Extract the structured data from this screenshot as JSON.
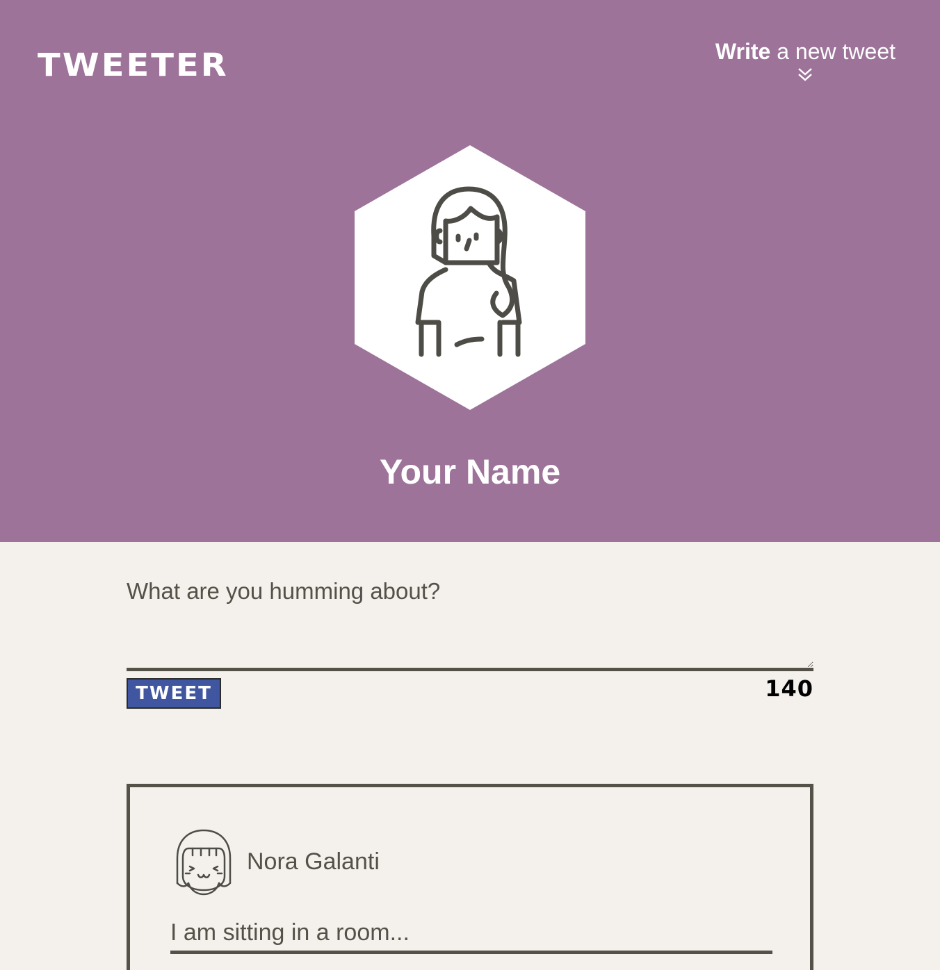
{
  "header": {
    "brand": "TWEETER",
    "compose_toggle": {
      "bold": "Write",
      "rest": " a new tweet"
    },
    "profile": {
      "first": "Your",
      "last": " Name"
    },
    "background_color": "#9d7399"
  },
  "composer": {
    "placeholder": "What are you humming about?",
    "submit_label": "TWEET",
    "char_count": "140",
    "button_color": "#4056a1"
  },
  "tweets": [
    {
      "author": "Nora Galanti",
      "text": "I am sitting in a room..."
    }
  ],
  "icons": {
    "compose_chevron": "chevrons-down-icon",
    "profile_avatar": "girl-avatar-icon",
    "tweet_avatar": "smiling-girl-avatar-icon"
  }
}
